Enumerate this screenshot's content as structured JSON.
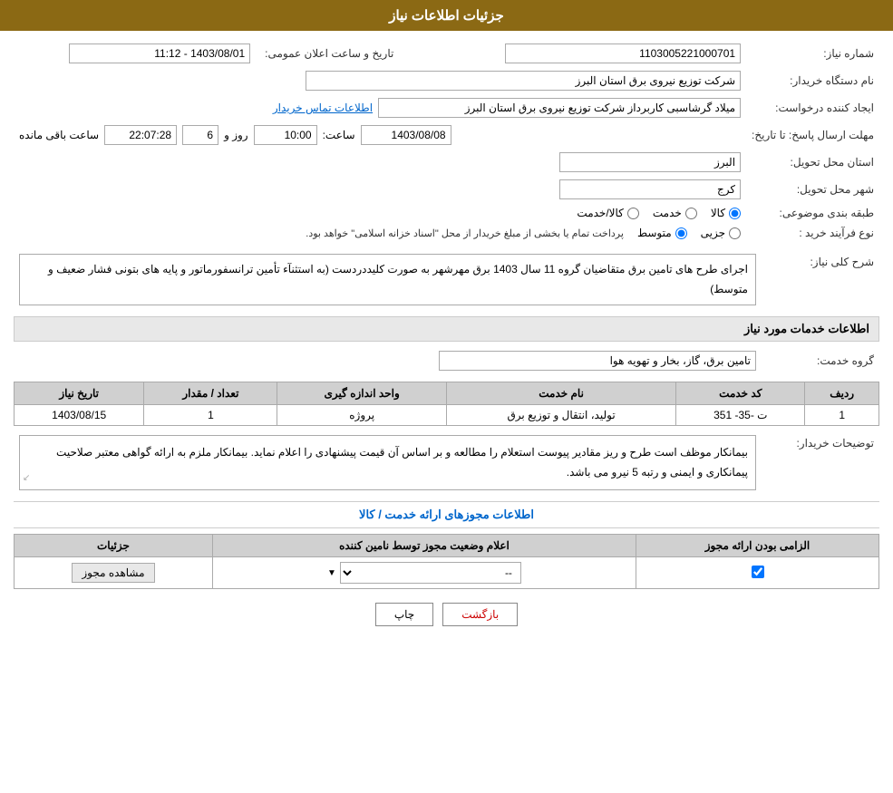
{
  "header": {
    "title": "جزئیات اطلاعات نیاز"
  },
  "fields": {
    "request_number_label": "شماره نیاز:",
    "request_number_value": "1103005221000701",
    "buyer_name_label": "نام دستگاه خریدار:",
    "buyer_name_value": "شرکت توزیع نیروی برق استان البرز",
    "creator_label": "ایجاد کننده درخواست:",
    "creator_value": "میلاد گرشاسبی کاربرداز شرکت توزیع نیروی برق استان البرز",
    "creator_link": "اطلاعات تماس خریدار",
    "response_deadline_label": "مهلت ارسال پاسخ: تا تاریخ:",
    "date_value": "1403/08/08",
    "time_label": "ساعت:",
    "time_value": "10:00",
    "days_label": "روز و",
    "days_value": "6",
    "remaining_label": "ساعت باقی مانده",
    "remaining_value": "22:07:28",
    "province_label": "استان محل تحویل:",
    "province_value": "البرز",
    "city_label": "شهر محل تحویل:",
    "city_value": "کرج",
    "category_label": "طبقه بندی موضوعی:",
    "category_options": [
      "کالا",
      "خدمت",
      "کالا/خدمت"
    ],
    "category_selected": "کالا",
    "process_label": "نوع فرآیند خرید :",
    "process_options": [
      "جزیی",
      "متوسط"
    ],
    "process_note": "پرداخت تمام یا بخشی از مبلغ خریدار از محل \"اسناد خزانه اسلامی\" خواهد بود.",
    "process_selected": "متوسط",
    "public_announcement_label": "تاریخ و ساعت اعلان عمومی:",
    "public_announcement_value": "1403/08/01 - 11:12"
  },
  "description_section": {
    "title": "شرح کلی نیاز:",
    "text": "اجرای طرح های تامین برق متقاضیان گروه 11 سال 1403 برق مهرشهر به صورت کلیددردست (به استثنآء تأمین ترانسفورماتور و پایه های بتونی فشار ضعیف و متوسط)"
  },
  "services_section": {
    "title": "اطلاعات خدمات مورد نیاز",
    "service_group_label": "گروه خدمت:",
    "service_group_value": "تامین برق، گاز، بخار و تهویه هوا",
    "table_headers": [
      "ردیف",
      "کد خدمت",
      "نام خدمت",
      "واحد اندازه گیری",
      "تعداد / مقدار",
      "تاریخ نیاز"
    ],
    "table_rows": [
      {
        "row": "1",
        "code": "ت -35- 351",
        "name": "تولید، انتقال و توزیع برق",
        "unit": "پروژه",
        "quantity": "1",
        "date": "1403/08/15"
      }
    ]
  },
  "buyer_notes": {
    "label": "توضیحات خریدار:",
    "text": "بیمانکار موظف است طرح و ریز مقادیر پیوست استعلام را مطالعه و بر اساس آن قیمت پیشنهادی را اعلام نماید.\nبیمانکار ملزم به ارائه گواهی معتبر صلاحیت پیمانکاری و ایمنی و رتبه 5 نیرو می باشد."
  },
  "licenses_section": {
    "title": "اطلاعات مجوزهای ارائه خدمت / کالا",
    "table_headers": [
      "الزامی بودن ارائه مجوز",
      "اعلام وضعیت مجوز توسط نامین کننده",
      "جزئیات"
    ],
    "table_rows": [
      {
        "required": true,
        "status": "--",
        "details_btn": "مشاهده مجوز"
      }
    ]
  },
  "buttons": {
    "print": "چاپ",
    "back": "بازگشت"
  }
}
